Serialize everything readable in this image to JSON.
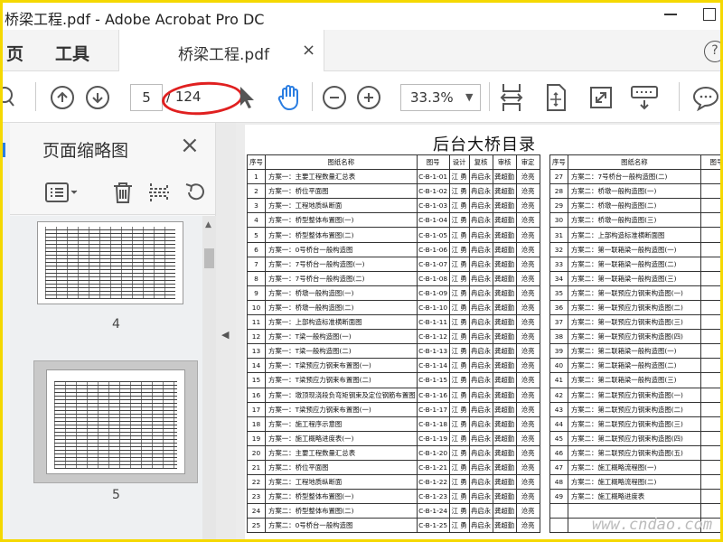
{
  "window": {
    "title": "桥梁工程.pdf - Adobe Acrobat Pro DC"
  },
  "tabs": {
    "home": "页",
    "tools": "工具",
    "document": "桥梁工程.pdf",
    "close": "×",
    "help": "?"
  },
  "toolbar": {
    "page_current": "5",
    "page_total": "/ 124",
    "zoom": "33.3%",
    "zoom_caret": "▼"
  },
  "panel": {
    "title": "页面缩略图",
    "close": "×",
    "thumb_pages": [
      "4",
      "5"
    ],
    "selected_page": "5"
  },
  "colors": {
    "highlight_oval": "#e02020",
    "window_border": "#f5d800"
  },
  "document": {
    "title": "后台大桥目录",
    "headers_left": [
      "序号",
      "图纸名称",
      "图号",
      "设计",
      "复核",
      "审核",
      "审定"
    ],
    "headers_right": [
      "序号",
      "图纸名称",
      "图号"
    ],
    "rows_left": [
      {
        "no": "1",
        "name": "方案一：主要工程数量汇总表",
        "code": "C-B-1-01"
      },
      {
        "no": "2",
        "name": "方案一：桥位平面图",
        "code": "C-B-1-02"
      },
      {
        "no": "3",
        "name": "方案一：工程地质纵断面",
        "code": "C-B-1-03"
      },
      {
        "no": "4",
        "name": "方案一：桥型整体布置图(一)",
        "code": "C-B-1-04"
      },
      {
        "no": "5",
        "name": "方案一：桥型整体布置图(二)",
        "code": "C-B-1-05"
      },
      {
        "no": "6",
        "name": "方案一：0号桥台一般构造图",
        "code": "C-B-1-06"
      },
      {
        "no": "7",
        "name": "方案一：7号桥台一般构造图(一)",
        "code": "C-B-1-07"
      },
      {
        "no": "8",
        "name": "方案一：7号桥台一般构造图(二)",
        "code": "C-B-1-08"
      },
      {
        "no": "9",
        "name": "方案一：桥墩一般构造图(一)",
        "code": "C-B-1-09"
      },
      {
        "no": "10",
        "name": "方案一：桥墩一般构造图(二)",
        "code": "C-B-1-10"
      },
      {
        "no": "11",
        "name": "方案一：上部构造标准横断面图",
        "code": "C-B-1-11"
      },
      {
        "no": "12",
        "name": "方案一：T梁一般构造图(一)",
        "code": "C-B-1-12"
      },
      {
        "no": "13",
        "name": "方案一：T梁一般构造图(二)",
        "code": "C-B-1-13"
      },
      {
        "no": "14",
        "name": "方案一：T梁预应力钢束布置图(一)",
        "code": "C-B-1-14"
      },
      {
        "no": "15",
        "name": "方案一：T梁预应力钢束布置图(二)",
        "code": "C-B-1-15"
      },
      {
        "no": "16",
        "name": "方案一：墩顶现浇段负弯矩钢束及定位钢筋布置图",
        "code": "C-B-1-16"
      },
      {
        "no": "17",
        "name": "方案一：T梁预应力钢束布置图(一)",
        "code": "C-B-1-17"
      },
      {
        "no": "18",
        "name": "方案一：施工程序示意图",
        "code": "C-B-1-18"
      },
      {
        "no": "19",
        "name": "方案一：施工概略进度表(一)",
        "code": "C-B-1-19"
      },
      {
        "no": "20",
        "name": "方案二：主要工程数量汇总表",
        "code": "C-B-1-20"
      },
      {
        "no": "21",
        "name": "方案二：桥位平面图",
        "code": "C-B-1-21"
      },
      {
        "no": "22",
        "name": "方案二：工程地质纵断面",
        "code": "C-B-1-22"
      },
      {
        "no": "23",
        "name": "方案二：桥型整体布置图(一)",
        "code": "C-B-1-23"
      },
      {
        "no": "24",
        "name": "方案二：桥型整体布置图(二)",
        "code": "C-B-1-24"
      },
      {
        "no": "25",
        "name": "方案二：0号桥台一般构造图",
        "code": "C-B-1-25"
      }
    ],
    "signers": {
      "design": "江 勇",
      "review": "冉启永",
      "audit": "龚超勤",
      "approve": "沧亮"
    },
    "rows_right": [
      {
        "no": "27",
        "name": "方案二：7号桥台一般构造图(二)"
      },
      {
        "no": "28",
        "name": "方案二：桥墩一般构造图(一)"
      },
      {
        "no": "29",
        "name": "方案二：桥墩一般构造图(二)"
      },
      {
        "no": "30",
        "name": "方案二：桥墩一般构造图(三)"
      },
      {
        "no": "31",
        "name": "方案二：上部构造标准横断面图"
      },
      {
        "no": "32",
        "name": "方案二：第一联箱梁一般构造图(一)"
      },
      {
        "no": "33",
        "name": "方案二：第一联箱梁一般构造图(二)"
      },
      {
        "no": "34",
        "name": "方案二：第一联箱梁一般构造图(三)"
      },
      {
        "no": "35",
        "name": "方案二：第一联预应力钢束构造图(一)"
      },
      {
        "no": "36",
        "name": "方案二：第一联预应力钢束构造图(二)"
      },
      {
        "no": "37",
        "name": "方案二：第一联预应力钢束构造图(三)"
      },
      {
        "no": "38",
        "name": "方案二：第一联预应力钢束构造图(四)"
      },
      {
        "no": "39",
        "name": "方案二：第二联箱梁一般构造图(一)"
      },
      {
        "no": "40",
        "name": "方案二：第二联箱梁一般构造图(二)"
      },
      {
        "no": "41",
        "name": "方案二：第二联箱梁一般构造图(三)"
      },
      {
        "no": "42",
        "name": "方案二：第二联预应力钢束构造图(一)"
      },
      {
        "no": "43",
        "name": "方案二：第二联预应力钢束构造图(二)"
      },
      {
        "no": "44",
        "name": "方案二：第二联预应力钢束构造图(三)"
      },
      {
        "no": "45",
        "name": "方案二：第二联预应力钢束构造图(四)"
      },
      {
        "no": "46",
        "name": "方案二：第二联预应力钢束构造图(五)"
      },
      {
        "no": "47",
        "name": "方案二：施工概略流程图(一)"
      },
      {
        "no": "48",
        "name": "方案二：施工概略流程图(二)"
      },
      {
        "no": "49",
        "name": "方案二：施工概略进度表"
      }
    ]
  },
  "watermark": "www.cndao.com"
}
